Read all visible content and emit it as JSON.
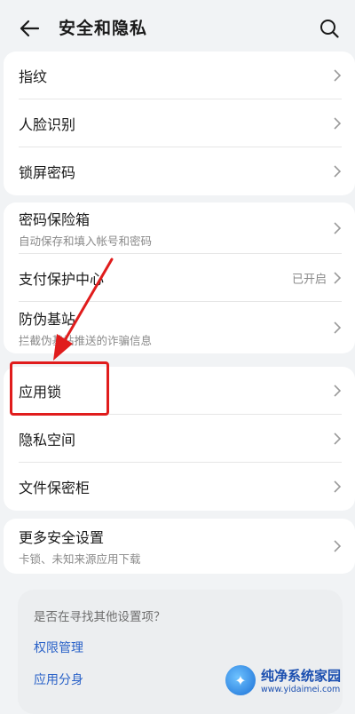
{
  "header": {
    "title": "安全和隐私"
  },
  "group1": [
    {
      "label": "指纹"
    },
    {
      "label": "人脸识别"
    },
    {
      "label": "锁屏密码"
    }
  ],
  "group2": [
    {
      "label": "密码保险箱",
      "sub": "自动保存和填入帐号和密码"
    },
    {
      "label": "支付保护中心",
      "status": "已开启"
    },
    {
      "label": "防伪基站",
      "sub": "拦截伪基站推送的诈骗信息"
    }
  ],
  "group3": [
    {
      "label": "应用锁"
    },
    {
      "label": "隐私空间"
    },
    {
      "label": "文件保密柜"
    }
  ],
  "group4": [
    {
      "label": "更多安全设置",
      "sub": "卡锁、未知来源应用下载"
    }
  ],
  "suggest": {
    "question": "是否在寻找其他设置项？",
    "links": [
      "权限管理",
      "应用分身"
    ]
  },
  "watermark": {
    "title": "纯净系统家园",
    "url": "www.yidaimei.com"
  },
  "colors": {
    "highlight": "#e01c1c",
    "link": "#2a62c8",
    "background": "#f1f3f5"
  }
}
